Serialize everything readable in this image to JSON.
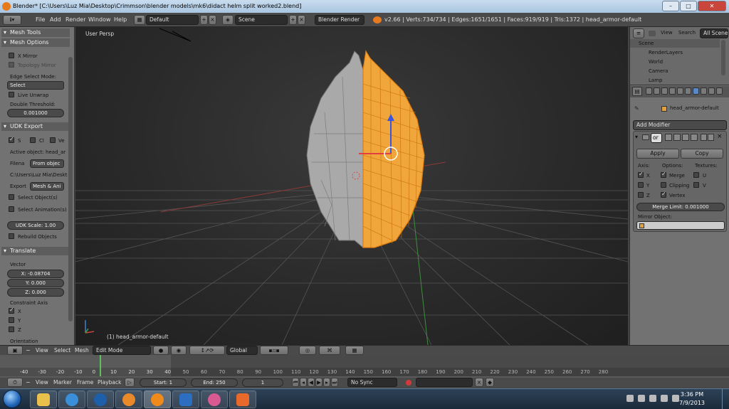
{
  "window": {
    "title": "Blender* [C:\\Users\\Luz Mia\\Desktop\\Crimmson\\blender models\\mk6\\didact helm split worked2.blend]",
    "btn_min": "–",
    "btn_max": "□",
    "btn_close": "✕"
  },
  "menubar": {
    "menus": [
      "File",
      "Add",
      "Render",
      "Window",
      "Help"
    ],
    "layout": "Default",
    "scene": "Scene",
    "engine": "Blender Render",
    "stats": "v2.66 | Verts:734/734 | Edges:1651/1651 | Faces:919/919 | Tris:1372 | head_armor-default"
  },
  "left_panel": {
    "mesh_tools": "Mesh Tools",
    "mesh_options": "Mesh Options",
    "x_mirror": "X Mirror",
    "topology_mirror": "Topology Mirror",
    "edge_select_mode_label": "Edge Select Mode:",
    "edge_select_mode": "Select",
    "live_unwrap": "Live Unwrap",
    "double_threshold_label": "Double Threshold:",
    "double_threshold": "0.001000",
    "udk_export": "UDK Export",
    "udk_s": "S",
    "udk_cl": "Cl",
    "udk_ve": "Ve",
    "active_object": "Active object: head_ar",
    "filename_label": "Filena",
    "filename_value": "From objec",
    "path": "C:\\Users\\Luz Mia\\Deskt",
    "export_label": "Export",
    "export_value": "Mesh & Ani",
    "select_objects": "Select Object(s)",
    "select_animations": "Select Animation(s)",
    "udk_scale": "UDK Scale: 1.00",
    "rebuild_objects": "Rebuild Objects",
    "translate": "Translate",
    "vector_label": "Vector",
    "vec_x": "X: -0.08704",
    "vec_y": "Y: 0.000",
    "vec_z": "Z: 0.000",
    "constraint_axis": "Constraint Axis",
    "axis_x": "X",
    "axis_y": "Y",
    "axis_z": "Z",
    "orientation": "Orientation"
  },
  "viewport": {
    "view_label": "User Persp",
    "object_label": "(1) head_armor-default"
  },
  "right_panel": {
    "view": "View",
    "search": "Search",
    "all_scenes": "All Scenes",
    "outliner": [
      "Scene",
      "RenderLayers",
      "World",
      "Camera",
      "Lamp"
    ],
    "object_path": "head_armor-default",
    "add_modifier": "Add Modifier",
    "mod_name": "or",
    "apply": "Apply",
    "copy": "Copy",
    "axis_label": "Axis:",
    "options_label": "Options:",
    "textures_label": "Textures:",
    "axis_x": "X",
    "axis_y": "Y",
    "axis_z": "Z",
    "merge": "Merge",
    "clipping": "Clipping",
    "vertex": "Vertex",
    "tex_u": "U",
    "tex_v": "V",
    "merge_limit": "Merge Limit: 0.001000",
    "mirror_object": "Mirror Object:"
  },
  "header3d": {
    "view": "View",
    "select": "Select",
    "mesh": "Mesh",
    "mode": "Edit Mode",
    "orientation": "Global"
  },
  "timeline": {
    "ticks": [
      "-40",
      "-30",
      "-20",
      "-10",
      "0",
      "10",
      "20",
      "30",
      "40",
      "50",
      "60",
      "70",
      "80",
      "90",
      "100",
      "110",
      "120",
      "130",
      "140",
      "150",
      "160",
      "170",
      "180",
      "190",
      "200",
      "210",
      "220",
      "230",
      "240",
      "250",
      "260",
      "270",
      "280"
    ],
    "view": "View",
    "marker": "Marker",
    "frame": "Frame",
    "playback": "Playback",
    "start": "Start: 1",
    "end": "End: 250",
    "current": "1",
    "sync": "No Sync"
  },
  "taskbar": {
    "time": "3:36 PM",
    "date": "7/9/2013"
  },
  "colors": {
    "selection_orange": "#f5a020",
    "mesh_gray": "#a9a9a9"
  }
}
